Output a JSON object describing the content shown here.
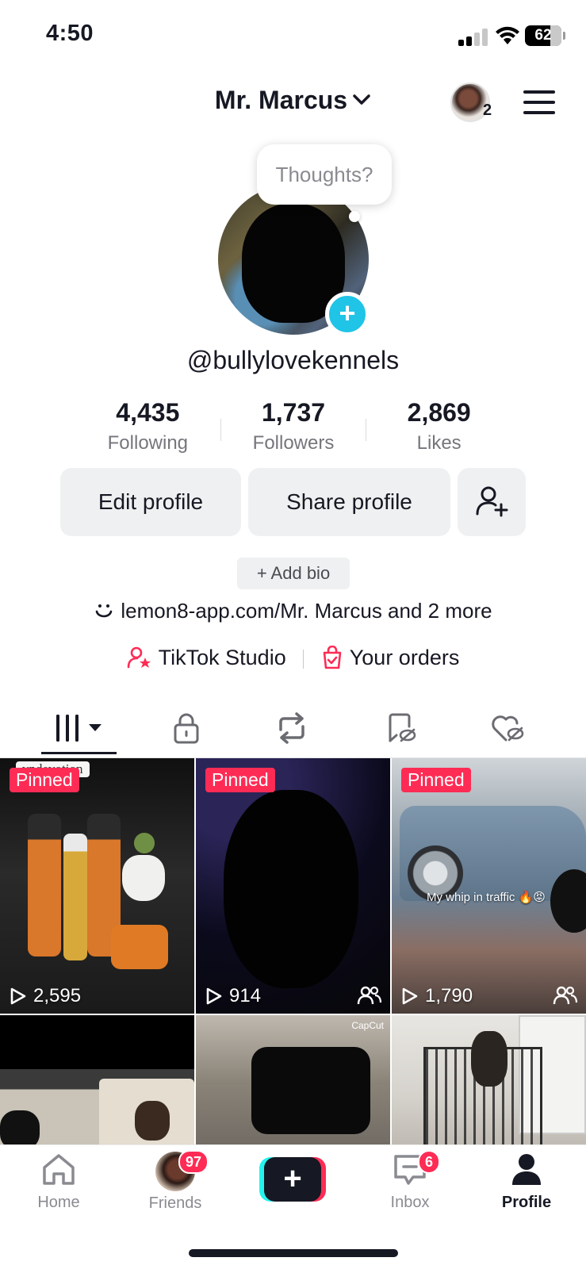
{
  "status_bar": {
    "time": "4:50",
    "battery": "62"
  },
  "header": {
    "display_name": "Mr. Marcus",
    "account_count": "2"
  },
  "profile": {
    "thought_bubble": "Thoughts?",
    "username": "@bullylovekennels",
    "stats": [
      {
        "value": "4,435",
        "label": "Following"
      },
      {
        "value": "1,737",
        "label": "Followers"
      },
      {
        "value": "2,869",
        "label": "Likes"
      }
    ],
    "edit_button": "Edit profile",
    "share_button": "Share profile",
    "add_bio": "+ Add bio",
    "link": "lemon8-app.com/Mr. Marcus and 2 more",
    "studio": "TikTok Studio",
    "orders": "Your orders"
  },
  "videos": [
    {
      "pinned": "Pinned",
      "views": "2,595",
      "overlay": "vndevotion",
      "has_collab": false
    },
    {
      "pinned": "Pinned",
      "views": "914",
      "has_collab": true
    },
    {
      "pinned": "Pinned",
      "views": "1,790",
      "overlay": "My whip in traffic 🔥😡",
      "has_collab": true
    },
    {
      "pinned": "",
      "views": ""
    },
    {
      "pinned": "",
      "views": "",
      "watermark": "CapCut"
    },
    {
      "pinned": "",
      "views": ""
    }
  ],
  "bottom_nav": {
    "home": "Home",
    "friends": "Friends",
    "friends_badge": "97",
    "inbox": "Inbox",
    "inbox_badge": "6",
    "profile": "Profile"
  },
  "colors": {
    "accent": "#fe2c55",
    "cyan": "#25f4ee",
    "add_button": "#20c4e6"
  }
}
